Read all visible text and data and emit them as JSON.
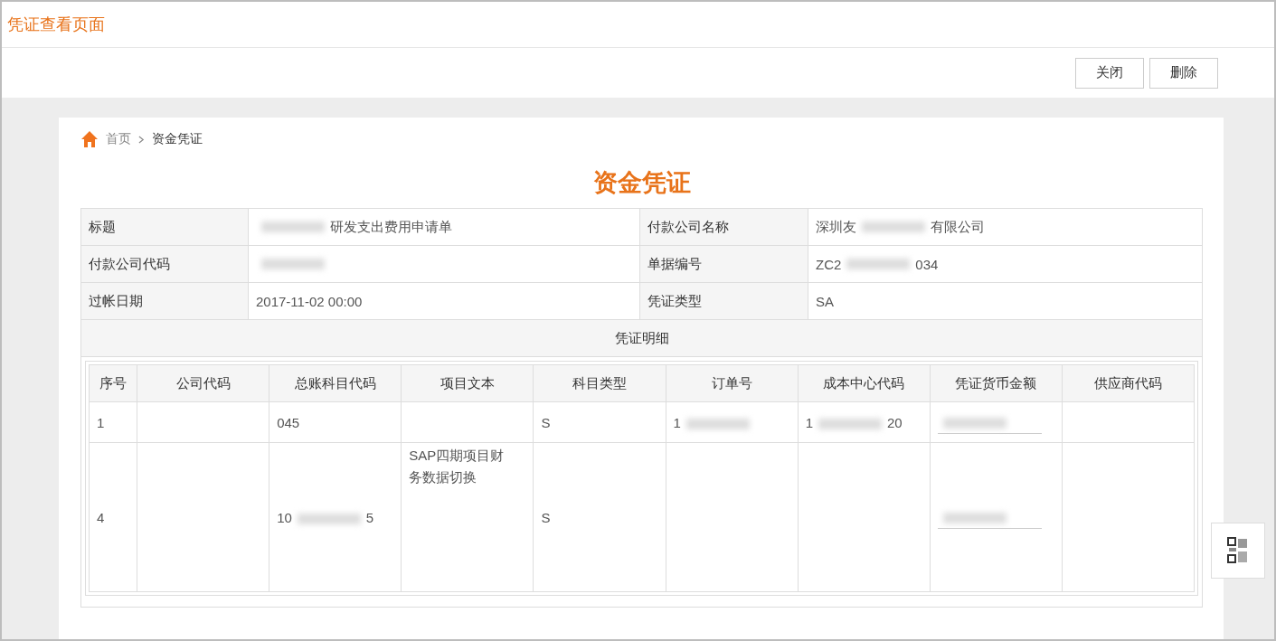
{
  "window": {
    "title": "凭证查看页面"
  },
  "toolbar": {
    "buttons": [
      "关闭",
      "删除"
    ]
  },
  "breadcrumb": [
    {
      "label": "首页",
      "kind": "link"
    },
    {
      "label": "资金凭证",
      "kind": "current"
    }
  ],
  "heading": "资金凭证",
  "info": [
    {
      "label": "标题",
      "value": [
        {
          "kind": "redacted"
        },
        {
          "kind": "text",
          "text": "研发支出费用申请单"
        }
      ]
    },
    {
      "label": "付款公司名称",
      "value": [
        {
          "kind": "text",
          "text": "深圳友"
        },
        {
          "kind": "redacted"
        },
        {
          "kind": "text",
          "text": "有限公司"
        }
      ]
    },
    {
      "label": "付款公司代码",
      "value": [
        {
          "kind": "redacted"
        }
      ]
    },
    {
      "label": "单据编号",
      "value": [
        {
          "kind": "text",
          "text": "ZC2"
        },
        {
          "kind": "redacted"
        },
        {
          "kind": "text",
          "text": "034"
        }
      ]
    },
    {
      "label": "过帐日期",
      "value": [
        {
          "kind": "text",
          "text": "2017-11-02 00:00"
        }
      ]
    },
    {
      "label": "凭证类型",
      "value": [
        {
          "kind": "text",
          "text": "SA"
        }
      ]
    }
  ],
  "detail": {
    "title": "凭证明细",
    "columns": [
      "序号",
      "公司代码",
      "总账科目代码",
      "项目文本",
      "科目类型",
      "订单号",
      "成本中心代码",
      "凭证货币金额",
      "供应商代码"
    ],
    "rows": [
      {
        "cells": [
          [
            {
              "kind": "text",
              "text": "1"
            }
          ],
          [],
          [
            {
              "kind": "text",
              "text": "045"
            }
          ],
          [],
          [
            {
              "kind": "text",
              "text": "S"
            }
          ],
          [
            {
              "kind": "text",
              "text": "1"
            },
            {
              "kind": "redacted"
            }
          ],
          [
            {
              "kind": "text",
              "text": "1"
            },
            {
              "kind": "redacted"
            },
            {
              "kind": "text",
              "text": "20"
            }
          ],
          [
            {
              "kind": "field"
            }
          ],
          []
        ]
      },
      {
        "cells": [
          [
            {
              "kind": "text",
              "text": "4"
            }
          ],
          [],
          [
            {
              "kind": "text",
              "text": "10"
            },
            {
              "kind": "redacted"
            },
            {
              "kind": "text",
              "text": "5"
            }
          ],
          [
            {
              "kind": "para",
              "text": "SAP四期项目财务数据切换"
            }
          ],
          [
            {
              "kind": "text",
              "text": "S"
            }
          ],
          [],
          [],
          [
            {
              "kind": "field"
            }
          ],
          []
        ]
      }
    ]
  }
}
